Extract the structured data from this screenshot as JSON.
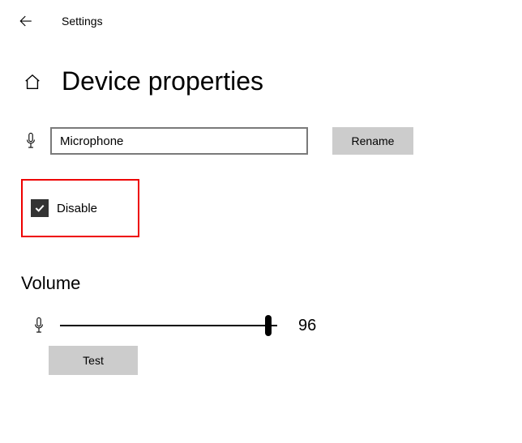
{
  "header": {
    "settings_label": "Settings"
  },
  "page": {
    "title": "Device properties"
  },
  "device": {
    "name": "Microphone",
    "rename_button": "Rename"
  },
  "disable": {
    "label": "Disable",
    "checked": true
  },
  "volume": {
    "section_title": "Volume",
    "value": 96,
    "test_button": "Test"
  }
}
